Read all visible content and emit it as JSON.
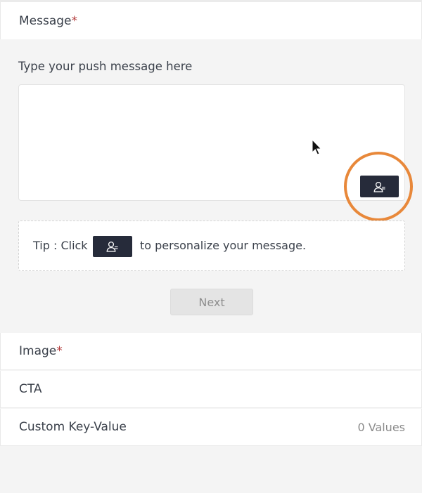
{
  "message_section": {
    "title": "Message",
    "required_mark": "*",
    "placeholder": "Type your push message here",
    "personalize_icon": "person-tag-icon",
    "accent_color": "#e8883a"
  },
  "tip": {
    "prefix": "Tip : Click",
    "suffix": "to personalize your message.",
    "icon": "person-tag-icon"
  },
  "next_label": "Next",
  "sections": {
    "image": {
      "title": "Image",
      "required_mark": "*"
    },
    "cta": {
      "title": "CTA"
    },
    "custom_kv": {
      "title": "Custom Key-Value",
      "count": "0 Values"
    }
  }
}
